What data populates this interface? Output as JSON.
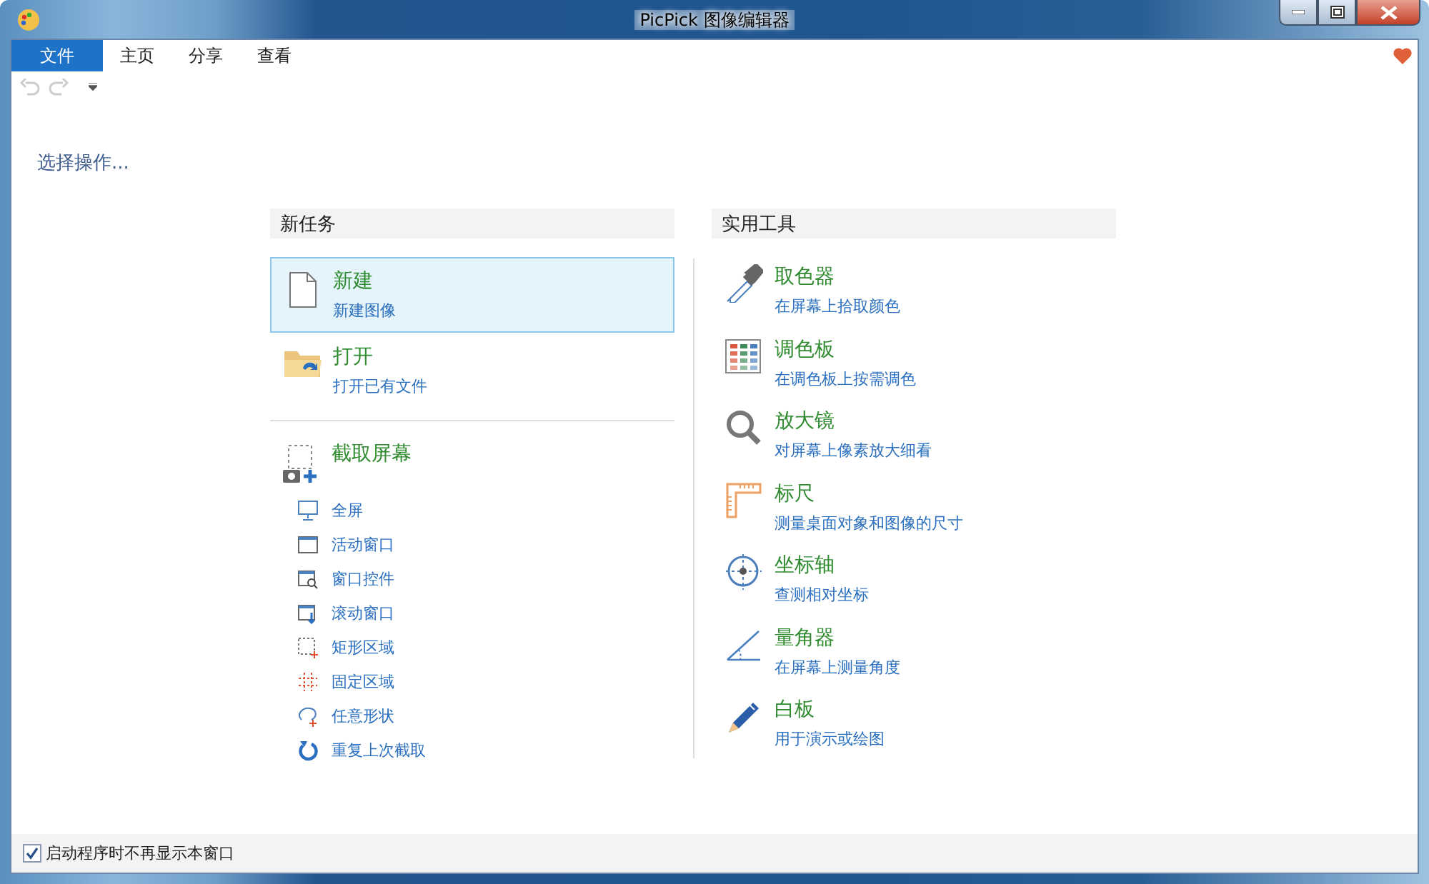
{
  "window": {
    "title": "PicPick 图像编辑器"
  },
  "tabs": [
    {
      "label": "文件",
      "selected": true
    },
    {
      "label": "主页",
      "selected": false
    },
    {
      "label": "分享",
      "selected": false
    },
    {
      "label": "查看",
      "selected": false
    }
  ],
  "prompt": "选择操作...",
  "new_task": {
    "title": "新任务",
    "items": [
      {
        "title": "新建",
        "subtitle": "新建图像",
        "selected": true
      },
      {
        "title": "打开",
        "subtitle": "打开已有文件",
        "selected": false
      }
    ],
    "capture": {
      "title": "截取屏幕",
      "items": [
        "全屏",
        "活动窗口",
        "窗口控件",
        "滚动窗口",
        "矩形区域",
        "固定区域",
        "任意形状",
        "重复上次截取"
      ]
    }
  },
  "tools": {
    "title": "实用工具",
    "items": [
      {
        "title": "取色器",
        "subtitle": "在屏幕上拾取颜色"
      },
      {
        "title": "调色板",
        "subtitle": "在调色板上按需调色"
      },
      {
        "title": "放大镜",
        "subtitle": "对屏幕上像素放大细看"
      },
      {
        "title": "标尺",
        "subtitle": "测量桌面对象和图像的尺寸"
      },
      {
        "title": "坐标轴",
        "subtitle": "查测相对坐标"
      },
      {
        "title": "量角器",
        "subtitle": "在屏幕上测量角度"
      },
      {
        "title": "白板",
        "subtitle": "用于演示或绘图"
      }
    ]
  },
  "startup_option": {
    "label": "启动程序时不再显示本窗口",
    "checked": true
  }
}
